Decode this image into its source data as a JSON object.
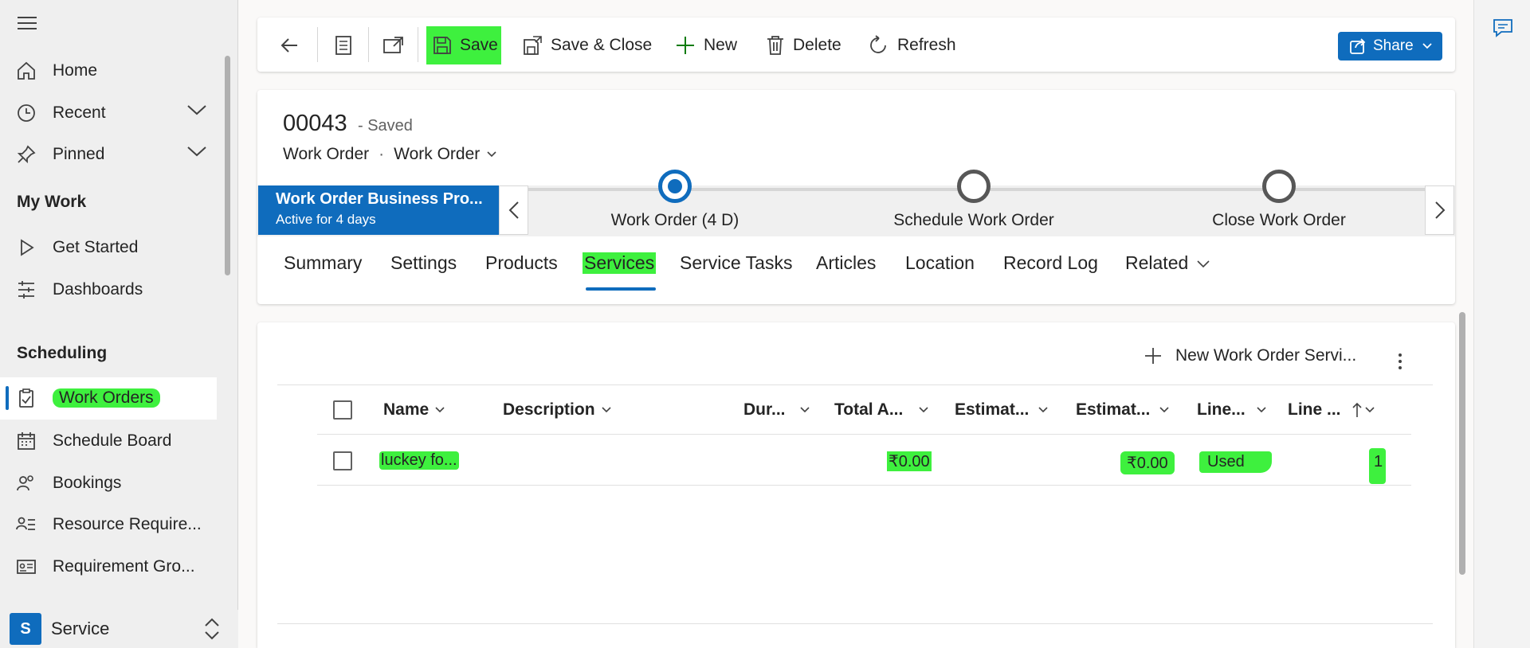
{
  "sidebar": {
    "home": "Home",
    "recent": "Recent",
    "pinned": "Pinned",
    "my_work_title": "My Work",
    "get_started": "Get Started",
    "dashboards": "Dashboards",
    "scheduling_title": "Scheduling",
    "work_orders": "Work Orders",
    "schedule_board": "Schedule Board",
    "bookings": "Bookings",
    "resource_requirements": "Resource Require...",
    "requirement_groups": "Requirement Gro...",
    "area_badge": "S",
    "area_name": "Service"
  },
  "toolbar": {
    "save": "Save",
    "save_close": "Save & Close",
    "new": "New",
    "delete": "Delete",
    "refresh": "Refresh",
    "share": "Share"
  },
  "record": {
    "number": "00043",
    "status": "- Saved",
    "entity": "Work Order",
    "form": "Work Order"
  },
  "bpf": {
    "name": "Work Order Business Pro...",
    "duration": "Active for 4 days",
    "stages": [
      "Work Order  (4 D)",
      "Schedule Work Order",
      "Close Work Order"
    ]
  },
  "tabs": [
    "Summary",
    "Settings",
    "Products",
    "Services",
    "Service Tasks",
    "Articles",
    "Location",
    "Record Log",
    "Related"
  ],
  "grid": {
    "new_button": "New Work Order Servi...",
    "columns": [
      "Name",
      "Description",
      "Dur...",
      "Total A...",
      "Estimat...",
      "Estimat...",
      "Line...",
      "Line ..."
    ],
    "rows": [
      {
        "name": "luckey fo...",
        "description": "",
        "duration": "",
        "total_amount": "₹0.00",
        "estimate_1": "",
        "estimate_2": "₹0.00",
        "line_status": "Used",
        "line_order": "1"
      }
    ]
  },
  "colors": {
    "accent": "#0f6cbd",
    "highlight": "#3ef03e"
  }
}
